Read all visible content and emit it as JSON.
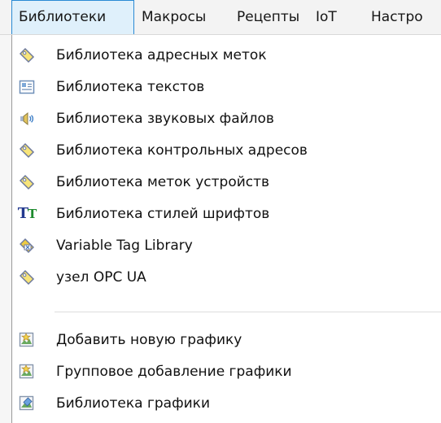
{
  "menubar": {
    "items": [
      "Библиотеки",
      "Макросы",
      "Рецепты",
      "IoT",
      "Настро"
    ],
    "active_index": 0
  },
  "dropdown": {
    "items": [
      {
        "label": "Библиотека адресных меток",
        "icon": "tag-icon"
      },
      {
        "label": "Библиотека текстов",
        "icon": "text-library-icon"
      },
      {
        "label": "Библиотека звуковых файлов",
        "icon": "sound-icon"
      },
      {
        "label": "Библиотека контрольных адресов",
        "icon": "tag-icon"
      },
      {
        "label": "Библиотека меток устройств",
        "icon": "tag-icon"
      },
      {
        "label": "Библиотека стилей шрифтов",
        "icon": "font-style-icon"
      },
      {
        "label": "Variable Tag Library",
        "icon": "variable-tag-icon"
      },
      {
        "label": "узел OPC UA",
        "icon": "tag-icon"
      },
      {
        "label": "Добавить новую графику",
        "icon": "add-graphic-icon"
      },
      {
        "label": "Групповое добавление графики",
        "icon": "group-add-graphic-icon"
      },
      {
        "label": "Библиотека графики",
        "icon": "graphic-library-icon"
      }
    ]
  }
}
